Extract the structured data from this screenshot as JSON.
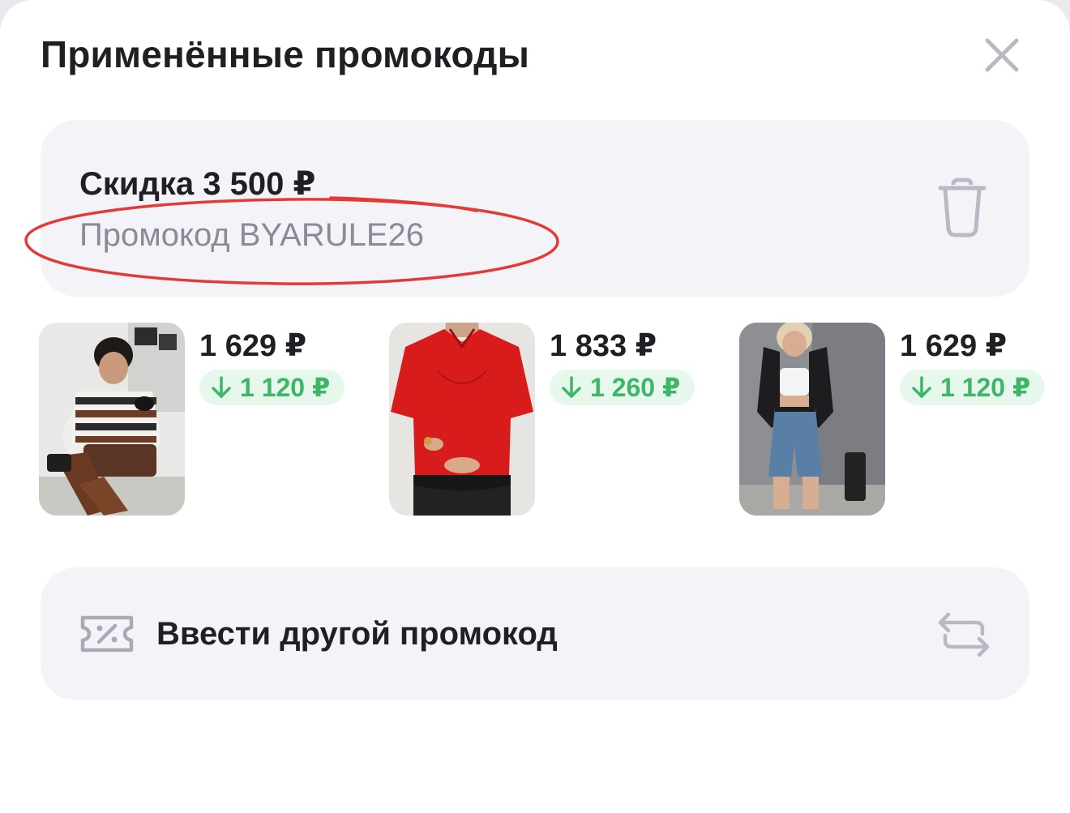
{
  "header": {
    "title": "Применённые промокоды",
    "close_icon": "close-icon"
  },
  "applied_promo": {
    "discount_label": "Скидка 3 500 ₽",
    "code_label": "Промокод BYARULE26",
    "delete_icon": "trash-icon",
    "annotation_color": "#e53935"
  },
  "products": [
    {
      "price": "1 629 ₽",
      "discount": "1 120 ₽",
      "image": "product-photo-striped-polo"
    },
    {
      "price": "1 833 ₽",
      "discount": "1 260 ₽",
      "image": "product-photo-red-blouse"
    },
    {
      "price": "1 629 ₽",
      "discount": "1 120 ₽",
      "image": "product-photo-denim-shorts"
    }
  ],
  "other_promo": {
    "label": "Ввести другой промокод",
    "coupon_icon": "coupon-icon",
    "swap_icon": "swap-icon"
  },
  "colors": {
    "accent_green": "#3fb56a",
    "badge_bg": "#e6f7ec",
    "card_bg": "#f4f4f8",
    "muted_text": "#8a8a99",
    "icon_gray": "#b9b9c6"
  }
}
